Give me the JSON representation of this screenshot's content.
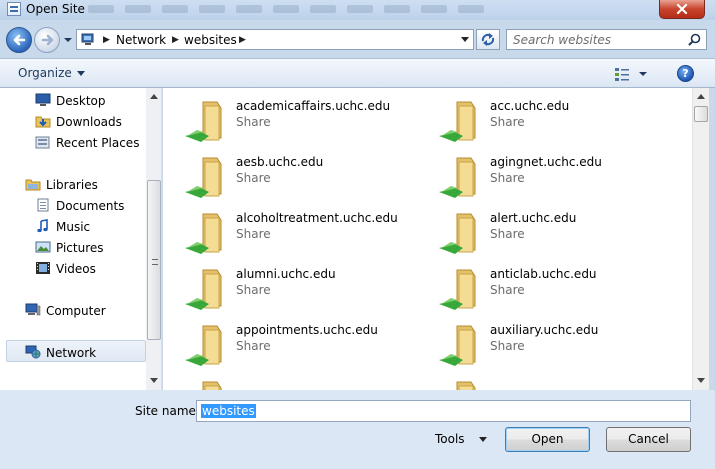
{
  "window": {
    "title": "Open Site"
  },
  "address": {
    "crumbs": [
      "Network",
      "websites"
    ]
  },
  "search": {
    "placeholder": "Search websites"
  },
  "toolbar": {
    "organize_label": "Organize",
    "help_label": "?"
  },
  "nav": {
    "items": [
      {
        "label": "Desktop",
        "icon": "desktop-icon"
      },
      {
        "label": "Downloads",
        "icon": "downloads-icon"
      },
      {
        "label": "Recent Places",
        "icon": "recent-places-icon"
      },
      {
        "label": "Libraries",
        "icon": "libraries-icon"
      },
      {
        "label": "Documents",
        "icon": "documents-icon"
      },
      {
        "label": "Music",
        "icon": "music-icon"
      },
      {
        "label": "Pictures",
        "icon": "pictures-icon"
      },
      {
        "label": "Videos",
        "icon": "videos-icon"
      },
      {
        "label": "Computer",
        "icon": "computer-icon"
      },
      {
        "label": "Network",
        "icon": "network-icon",
        "selected": true
      }
    ]
  },
  "files": {
    "items": [
      {
        "name": "academicaffairs.uchc.edu",
        "type": "Share"
      },
      {
        "name": "acc.uchc.edu",
        "type": "Share"
      },
      {
        "name": "aesb.uchc.edu",
        "type": "Share"
      },
      {
        "name": "agingnet.uchc.edu",
        "type": "Share"
      },
      {
        "name": "alcoholtreatment.uchc.edu",
        "type": "Share"
      },
      {
        "name": "alert.uchc.edu",
        "type": "Share"
      },
      {
        "name": "alumni.uchc.edu",
        "type": "Share"
      },
      {
        "name": "anticlab.uchc.edu",
        "type": "Share"
      },
      {
        "name": "appointments.uchc.edu",
        "type": "Share"
      },
      {
        "name": "auxiliary.uchc.edu",
        "type": "Share"
      }
    ]
  },
  "footer": {
    "site_name_label": "Site name:",
    "site_name_value": "websites",
    "tools_label": "Tools",
    "open_label": "Open",
    "cancel_label": "Cancel"
  },
  "colors": {
    "selection": "#3399ff",
    "titlebar": "#bcd1ea",
    "close_button": "#c8442d"
  }
}
